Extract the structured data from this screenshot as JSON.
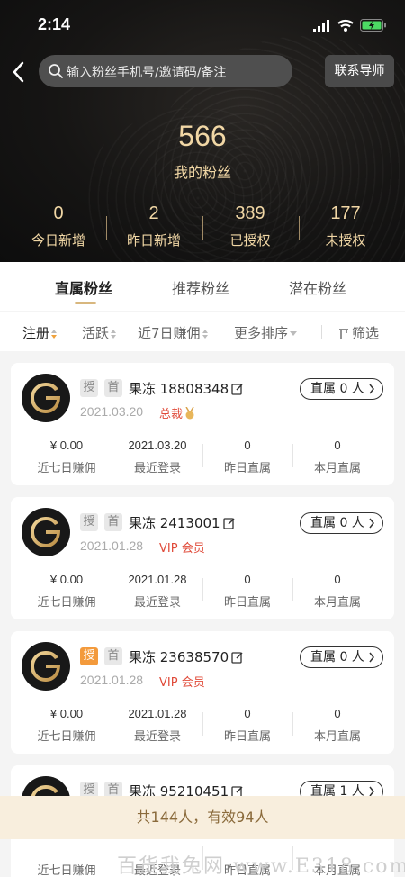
{
  "status_bar": {
    "time": "2:14",
    "battery_color": "#4cd964"
  },
  "search": {
    "placeholder": "输入粉丝手机号/邀请码/备注"
  },
  "header": {
    "contact_button": "联系导师"
  },
  "fans": {
    "count": "566",
    "label": "我的粉丝"
  },
  "stats": [
    {
      "value": "0",
      "label": "今日新增"
    },
    {
      "value": "2",
      "label": "昨日新增"
    },
    {
      "value": "389",
      "label": "已授权"
    },
    {
      "value": "177",
      "label": "未授权"
    }
  ],
  "tabs": [
    {
      "label": "直属粉丝",
      "active": true
    },
    {
      "label": "推荐粉丝",
      "active": false
    },
    {
      "label": "潜在粉丝",
      "active": false
    }
  ],
  "sort": {
    "register": "注册",
    "active": "活跃",
    "commission7": "近7日赚佣",
    "more": "更多排序",
    "filter": "筛选"
  },
  "metric_labels": [
    "近七日赚佣",
    "最近登录",
    "昨日直属",
    "本月直属"
  ],
  "cards": [
    {
      "tag_auth": "授",
      "tag_first": "首",
      "auth_highlight": false,
      "name": "果冻 18808348",
      "date": "2021.03.20",
      "level": "总裁",
      "direct": "直属 0 人",
      "metrics": [
        "¥ 0.00",
        "2021.03.20",
        "0",
        "0"
      ]
    },
    {
      "tag_auth": "授",
      "tag_first": "首",
      "auth_highlight": false,
      "name": "果冻 2413001",
      "date": "2021.01.28",
      "level": "VIP 会员",
      "direct": "直属 0 人",
      "metrics": [
        "¥ 0.00",
        "2021.01.28",
        "0",
        "0"
      ]
    },
    {
      "tag_auth": "授",
      "tag_first": "首",
      "auth_highlight": true,
      "name": "果冻 23638570",
      "date": "2021.01.28",
      "level": "VIP 会员",
      "direct": "直属 0 人",
      "metrics": [
        "¥ 0.00",
        "2021.01.28",
        "0",
        "0"
      ]
    },
    {
      "tag_auth": "授",
      "tag_first": "首",
      "auth_highlight": false,
      "name": "果冻 95210451",
      "date": "",
      "level": "",
      "direct": "直属 1 人",
      "metrics": [
        "",
        "",
        "",
        ""
      ]
    }
  ],
  "summary": "共144人，有效94人",
  "watermark": "百货我兔网  www.E318.com",
  "colors": {
    "gold": "#f1d7a5",
    "accent_tab": "#d8b77e",
    "level_red": "#e04b3a",
    "auth_orange": "#f39a3c"
  }
}
